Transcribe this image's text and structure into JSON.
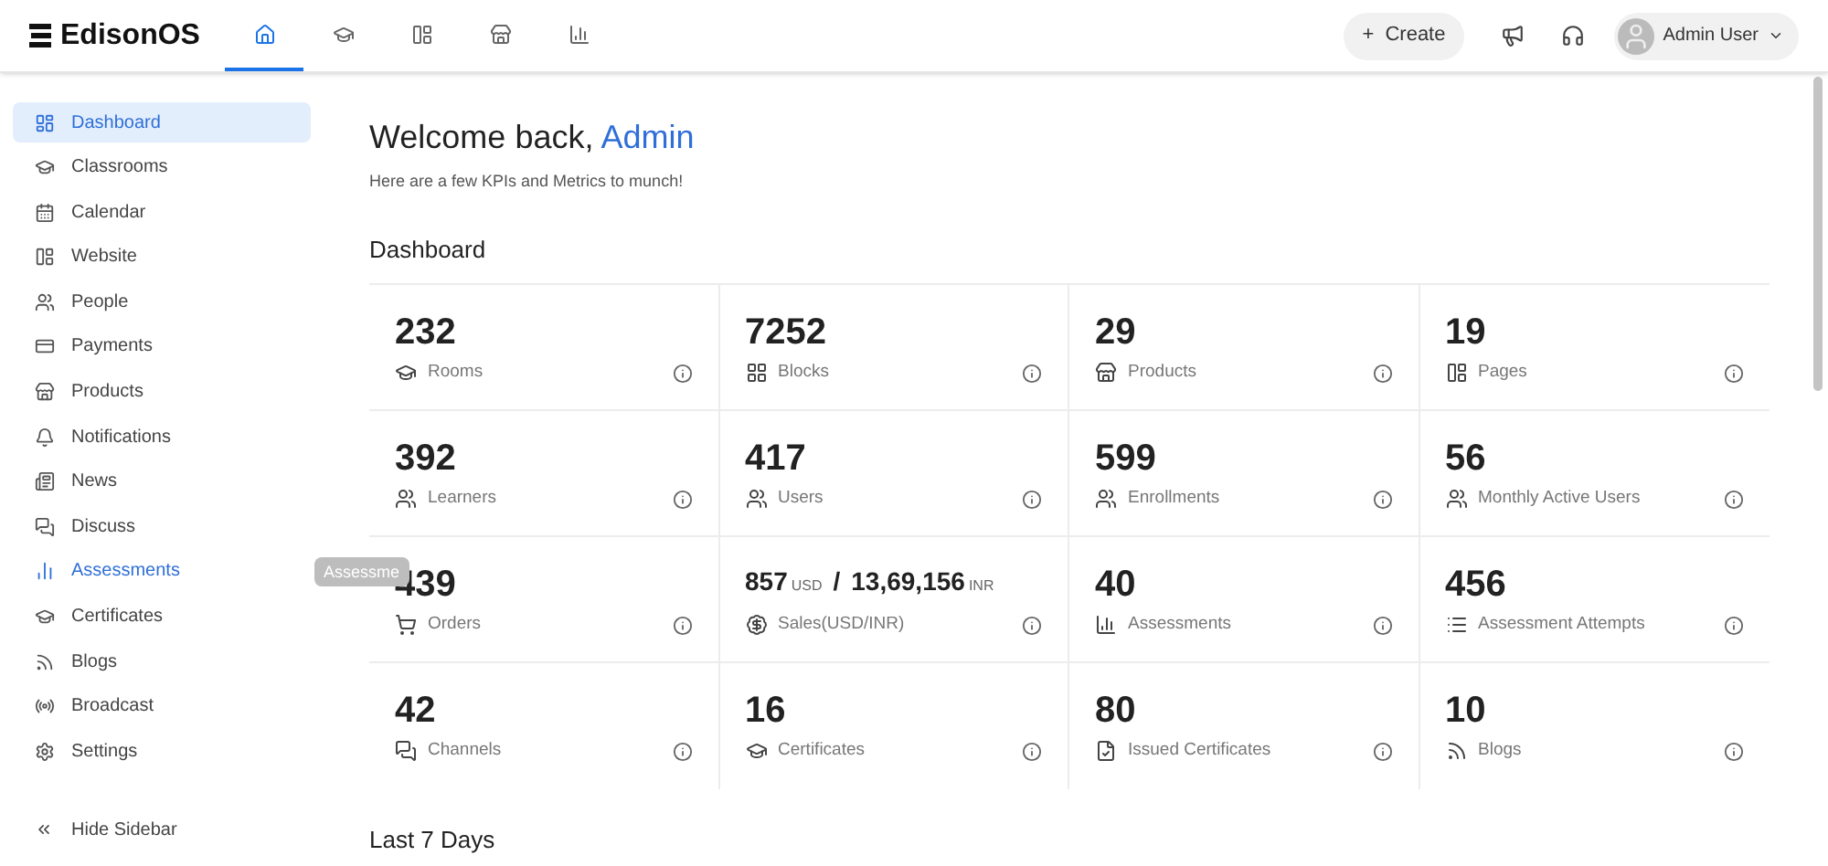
{
  "brand": "EdisonOS",
  "top_tabs": [
    {
      "selected": true
    },
    {
      "selected": false
    },
    {
      "selected": false
    },
    {
      "selected": false
    },
    {
      "selected": false
    }
  ],
  "create_button": {
    "icon": "+",
    "label": "Create"
  },
  "user": {
    "name": "Admin User"
  },
  "sidebar": {
    "items": [
      {
        "label": "Dashboard",
        "selected": true,
        "hovered": false
      },
      {
        "label": "Classrooms",
        "selected": false,
        "hovered": false
      },
      {
        "label": "Calendar",
        "selected": false,
        "hovered": false
      },
      {
        "label": "Website",
        "selected": false,
        "hovered": false
      },
      {
        "label": "People",
        "selected": false,
        "hovered": false
      },
      {
        "label": "Payments",
        "selected": false,
        "hovered": false
      },
      {
        "label": "Products",
        "selected": false,
        "hovered": false
      },
      {
        "label": "Notifications",
        "selected": false,
        "hovered": false
      },
      {
        "label": "News",
        "selected": false,
        "hovered": false
      },
      {
        "label": "Discuss",
        "selected": false,
        "hovered": false
      },
      {
        "label": "Assessments",
        "selected": false,
        "hovered": true
      },
      {
        "label": "Certificates",
        "selected": false,
        "hovered": false
      },
      {
        "label": "Blogs",
        "selected": false,
        "hovered": false
      },
      {
        "label": "Broadcast",
        "selected": false,
        "hovered": false
      },
      {
        "label": "Settings",
        "selected": false,
        "hovered": false
      }
    ],
    "tooltip": "Assessme",
    "hide_label": "Hide Sidebar"
  },
  "welcome": {
    "greeting": "Welcome back,",
    "name": "Admin",
    "subtitle": "Here are a few KPIs and Metrics to munch!"
  },
  "section_title": "Dashboard",
  "cards": [
    {
      "kind": "single",
      "value": "232",
      "label": "Rooms"
    },
    {
      "kind": "single",
      "value": "7252",
      "label": "Blocks"
    },
    {
      "kind": "single",
      "value": "29",
      "label": "Products"
    },
    {
      "kind": "single",
      "value": "19",
      "label": "Pages"
    },
    {
      "kind": "single",
      "value": "392",
      "label": "Learners"
    },
    {
      "kind": "single",
      "value": "417",
      "label": "Users"
    },
    {
      "kind": "single",
      "value": "599",
      "label": "Enrollments"
    },
    {
      "kind": "single",
      "value": "56",
      "label": "Monthly Active Users"
    },
    {
      "kind": "single",
      "value": "439",
      "label": "Orders"
    },
    {
      "kind": "dual",
      "amounts": [
        {
          "amount": "857",
          "unit": "USD"
        },
        {
          "amount": "13,69,156",
          "unit": "INR"
        }
      ],
      "separator": "/",
      "label": "Sales(USD/INR)"
    },
    {
      "kind": "single",
      "value": "40",
      "label": "Assessments"
    },
    {
      "kind": "single",
      "value": "456",
      "label": "Assessment Attempts"
    },
    {
      "kind": "single",
      "value": "42",
      "label": "Channels"
    },
    {
      "kind": "single",
      "value": "16",
      "label": "Certificates"
    },
    {
      "kind": "single",
      "value": "80",
      "label": "Issued Certificates"
    },
    {
      "kind": "single",
      "value": "10",
      "label": "Blogs"
    }
  ],
  "next_section_title": "Last 7 Days"
}
